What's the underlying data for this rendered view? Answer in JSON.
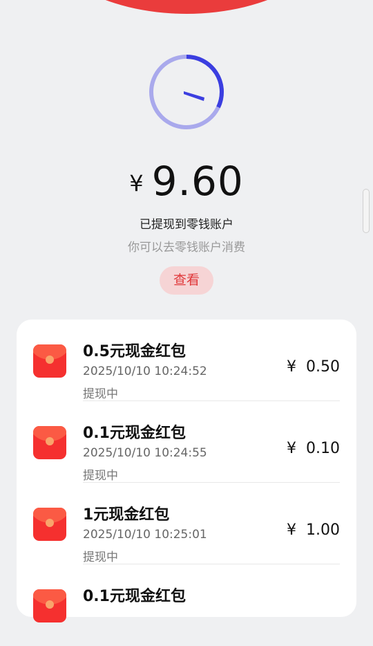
{
  "balance": {
    "currency": "¥",
    "amount": "9.60",
    "status_main": "已提现到零钱账户",
    "status_sub": "你可以去零钱账户消费",
    "view_button": "查看"
  },
  "records": [
    {
      "title": "0.5元现金红包",
      "time": "2025/10/10 10:24:52",
      "status": "提现中",
      "currency": "¥",
      "amount": "0.50"
    },
    {
      "title": "0.1元现金红包",
      "time": "2025/10/10 10:24:55",
      "status": "提现中",
      "currency": "¥",
      "amount": "0.10"
    },
    {
      "title": "1元现金红包",
      "time": "2025/10/10 10:25:01",
      "status": "提现中",
      "currency": "¥",
      "amount": "1.00"
    },
    {
      "title": "0.1元现金红包",
      "time": "",
      "status": "",
      "currency": "",
      "amount": ""
    }
  ],
  "colors": {
    "brand_red": "#ea3c3c",
    "clock_ring": "#a9a9ec",
    "clock_accent": "#3b3ee0",
    "view_button_bg": "#f6d4d5",
    "view_button_text": "#e0383a"
  },
  "icons": {
    "clock": "clock-icon",
    "red_packet": "red-packet-icon"
  }
}
